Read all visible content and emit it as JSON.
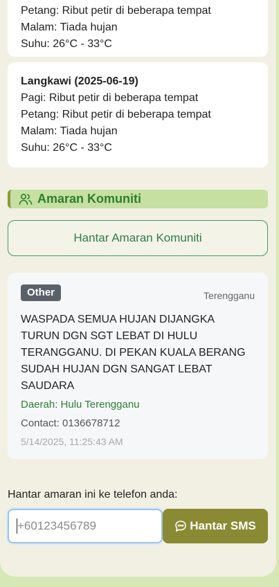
{
  "forecast_cards": [
    {
      "petang": "Petang: Ribut petir di beberapa tempat",
      "malam": "Malam: Tiada hujan",
      "suhu": "Suhu: 26°C - 33°C"
    },
    {
      "title": "Langkawi (2025-06-19)",
      "pagi": "Pagi: Ribut petir di beberapa tempat",
      "petang": "Petang: Ribut petir di beberapa tempat",
      "malam": "Malam: Tiada hujan",
      "suhu": "Suhu: 26°C - 33°C"
    }
  ],
  "community": {
    "heading": "Amaran Komuniti",
    "heading_icon": "users-icon",
    "send_button": "Hantar Amaran Komuniti"
  },
  "alert": {
    "category": "Other",
    "region": "Terengganu",
    "message": "WASPADA SEMUA HUJAN DIJANGKA TURUN DGN SGT LEBAT DI HULU TERANGGANU. DI PEKAN KUALA BERANG SUDAH HUJAN DGN SANGAT LEBAT SAUDARA",
    "area": "Daerah: Hulu Terengganu",
    "contact": "Contact: 0136678712",
    "timestamp": "5/14/2025, 11:25:43 AM"
  },
  "sms": {
    "label": "Hantar amaran ini ke telefon anda:",
    "placeholder": "+60123456789",
    "button": "Hantar SMS",
    "button_icon": "chat-icon"
  },
  "colors": {
    "accent_green": "#2e7d32",
    "sms_button": "#8a8a34",
    "page_bg": "#f1f0e2",
    "section_bg": "#c5e0a0"
  }
}
